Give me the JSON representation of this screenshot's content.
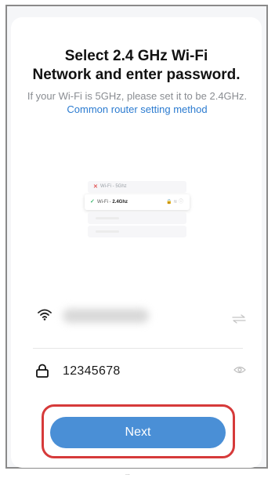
{
  "header": {
    "title_line1": "Select 2.4 GHz Wi-Fi",
    "title_line2": "Network and enter password."
  },
  "description": {
    "text": "If your Wi-Fi is 5GHz, please set it to be 2.4GHz.",
    "link": "Common router setting method"
  },
  "illustration": {
    "row1_label": "Wi-Fi - 5Ghz",
    "row2_prefix": "Wi-Fi - ",
    "row2_band": "2.4Ghz",
    "row1_mark": "✕",
    "row2_mark": "✓",
    "row_icons": "🔒 ≋ ⓘ"
  },
  "wifi": {
    "icon": "wifi-icon",
    "switch_icon": "switch-network-icon"
  },
  "password": {
    "icon": "lock-icon",
    "value": "12345678",
    "toggle_icon": "eye-icon"
  },
  "actions": {
    "next_label": "Next"
  },
  "footer": {
    "mark": "..."
  },
  "colors": {
    "accent": "#4a8fd6",
    "link": "#2b7bd0",
    "highlight": "#d63a3a"
  }
}
